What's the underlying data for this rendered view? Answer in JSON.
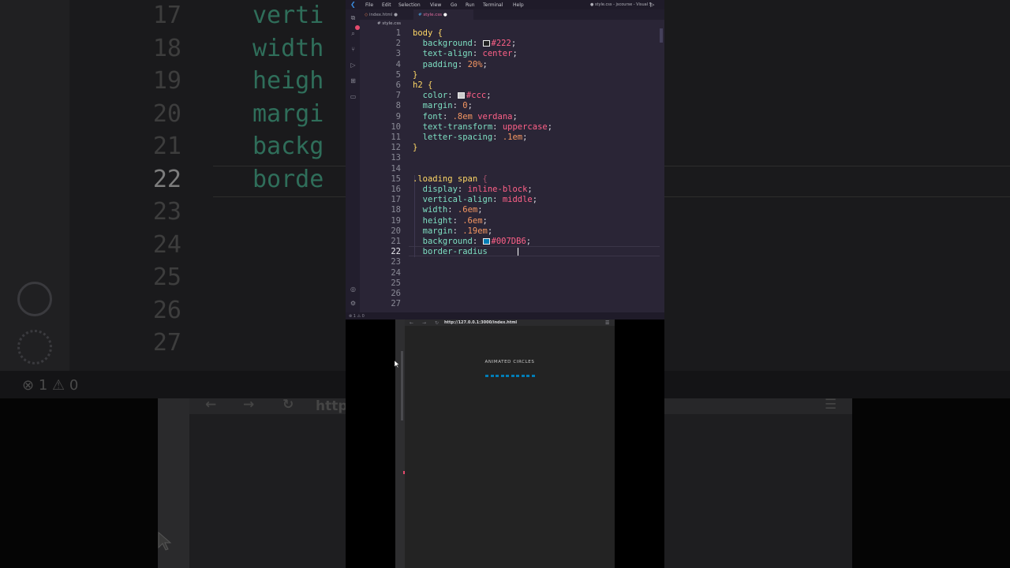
{
  "background": {
    "line_numbers": [
      "17",
      "18",
      "19",
      "20",
      "21",
      "22",
      "23",
      "24",
      "25",
      "26",
      "27"
    ],
    "active_line": "22",
    "code_fragments": [
      "verti",
      "width",
      "heigh",
      "margi",
      "backg",
      "borde"
    ],
    "status": {
      "errors": "1",
      "warnings": "0"
    },
    "url_fragment": "http"
  },
  "titlebar": {
    "menu": [
      "File",
      "Edit",
      "Selection",
      "View",
      "Go",
      "Run",
      "Terminal",
      "Help"
    ],
    "window_title": "● style.css - jscourse - Visual S"
  },
  "tabs": [
    {
      "label": "index.html",
      "icon": "html-icon",
      "modified": true
    },
    {
      "label": "style.css",
      "icon": "css-icon",
      "modified": true,
      "active": true
    }
  ],
  "breadcrumb": "# style.css",
  "code": {
    "lines": [
      {
        "n": "1",
        "segments": [
          [
            "sel",
            "body "
          ],
          [
            "brace",
            "{"
          ]
        ]
      },
      {
        "n": "2",
        "segments": [
          [
            "prop",
            "  background"
          ],
          [
            "punct",
            ": "
          ],
          [
            "swatch",
            "#222222"
          ],
          [
            "val",
            "#222"
          ],
          [
            "punct",
            ";"
          ]
        ]
      },
      {
        "n": "3",
        "segments": [
          [
            "prop",
            "  text-align"
          ],
          [
            "punct",
            ": "
          ],
          [
            "val",
            "center"
          ],
          [
            "punct",
            ";"
          ]
        ]
      },
      {
        "n": "4",
        "segments": [
          [
            "prop",
            "  padding"
          ],
          [
            "punct",
            ": "
          ],
          [
            "num",
            "20%"
          ],
          [
            "punct",
            ";"
          ]
        ]
      },
      {
        "n": "5",
        "segments": [
          [
            "brace",
            "}"
          ]
        ]
      },
      {
        "n": "6",
        "segments": [
          [
            "sel",
            "h2 "
          ],
          [
            "brace",
            "{"
          ]
        ]
      },
      {
        "n": "7",
        "segments": [
          [
            "prop",
            "  color"
          ],
          [
            "punct",
            ": "
          ],
          [
            "swatch",
            "#cccccc"
          ],
          [
            "val",
            "#ccc"
          ],
          [
            "punct",
            ";"
          ]
        ]
      },
      {
        "n": "8",
        "segments": [
          [
            "prop",
            "  margin"
          ],
          [
            "punct",
            ": "
          ],
          [
            "num",
            "0"
          ],
          [
            "punct",
            ";"
          ]
        ]
      },
      {
        "n": "9",
        "segments": [
          [
            "prop",
            "  font"
          ],
          [
            "punct",
            ": "
          ],
          [
            "num",
            ".8em"
          ],
          [
            "val",
            " verdana"
          ],
          [
            "punct",
            ";"
          ]
        ]
      },
      {
        "n": "10",
        "segments": [
          [
            "prop",
            "  text-transform"
          ],
          [
            "punct",
            ": "
          ],
          [
            "val",
            "uppercase"
          ],
          [
            "punct",
            ";"
          ]
        ]
      },
      {
        "n": "11",
        "segments": [
          [
            "prop",
            "  letter-spacing"
          ],
          [
            "punct",
            ": "
          ],
          [
            "num",
            ".1em"
          ],
          [
            "punct",
            ";"
          ]
        ]
      },
      {
        "n": "12",
        "segments": [
          [
            "brace",
            "}"
          ]
        ]
      },
      {
        "n": "13",
        "segments": []
      },
      {
        "n": "14",
        "segments": []
      },
      {
        "n": "15",
        "segments": [
          [
            "sel",
            ".loading span "
          ],
          [
            "brace-dim",
            "{"
          ]
        ]
      },
      {
        "n": "16",
        "segments": [
          [
            "prop",
            "  display"
          ],
          [
            "punct",
            ": "
          ],
          [
            "val",
            "inline-block"
          ],
          [
            "punct",
            ";"
          ]
        ]
      },
      {
        "n": "17",
        "segments": [
          [
            "prop",
            "  vertical-align"
          ],
          [
            "punct",
            ": "
          ],
          [
            "val",
            "middle"
          ],
          [
            "punct",
            ";"
          ]
        ]
      },
      {
        "n": "18",
        "segments": [
          [
            "prop",
            "  width"
          ],
          [
            "punct",
            ": "
          ],
          [
            "num",
            ".6em"
          ],
          [
            "punct",
            ";"
          ]
        ]
      },
      {
        "n": "19",
        "segments": [
          [
            "prop",
            "  height"
          ],
          [
            "punct",
            ": "
          ],
          [
            "num",
            ".6em"
          ],
          [
            "punct",
            ";"
          ]
        ]
      },
      {
        "n": "20",
        "segments": [
          [
            "prop",
            "  margin"
          ],
          [
            "punct",
            ": "
          ],
          [
            "num",
            ".19em"
          ],
          [
            "punct",
            ";"
          ]
        ]
      },
      {
        "n": "21",
        "segments": [
          [
            "prop",
            "  background"
          ],
          [
            "punct",
            ": "
          ],
          [
            "swatch",
            "#007DB6"
          ],
          [
            "val",
            "#007DB6"
          ],
          [
            "punct",
            ";"
          ]
        ]
      },
      {
        "n": "22",
        "segments": [
          [
            "prop",
            "  border-radius"
          ]
        ]
      },
      {
        "n": "23",
        "segments": []
      },
      {
        "n": "24",
        "segments": []
      },
      {
        "n": "25",
        "segments": []
      },
      {
        "n": "26",
        "segments": []
      },
      {
        "n": "27",
        "segments": []
      }
    ],
    "active_line": "22"
  },
  "statusbar": {
    "errors": "1",
    "warnings": "0"
  },
  "browser": {
    "url": "http://127.0.0.1:3000/index.html",
    "heading": "Animated Circles",
    "dot_color": "#007DB6",
    "dot_count": 10
  },
  "colors": {
    "editor_bg": "#2a2536",
    "accent_pink": "#e06c9f",
    "selector": "#ffd866",
    "property": "#7ee0c3",
    "value": "#ff6188"
  }
}
